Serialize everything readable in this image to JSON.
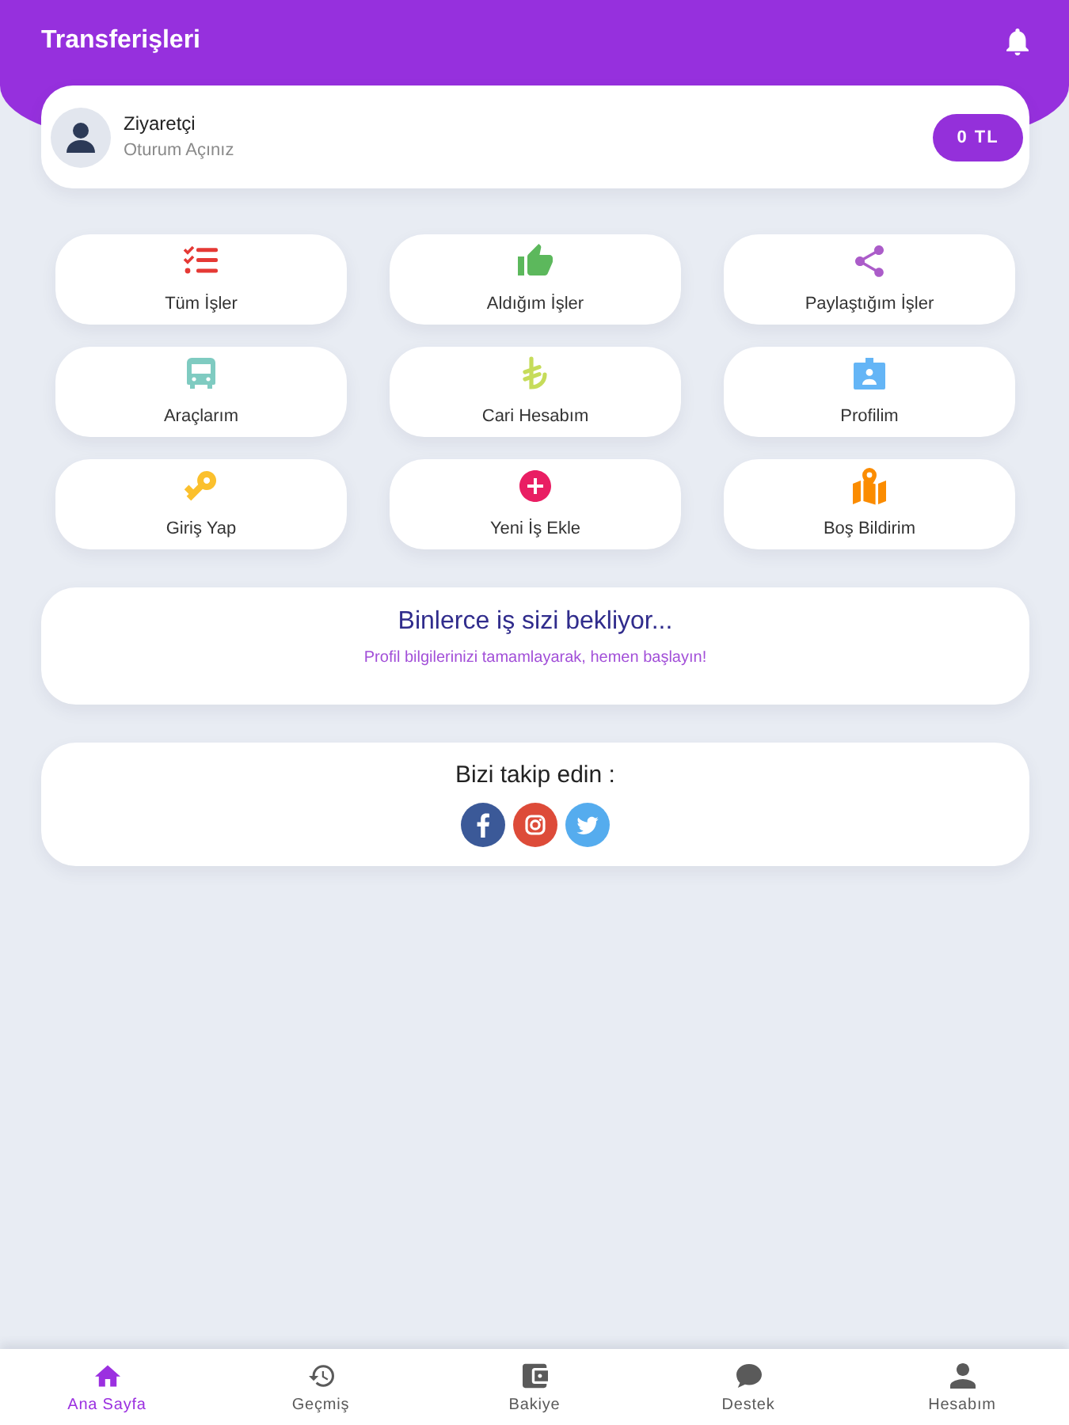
{
  "header": {
    "title": "Transferişleri"
  },
  "user_card": {
    "name": "Ziyaretçi",
    "status": "Oturum Açınız",
    "balance": "0 TL"
  },
  "menu": [
    {
      "label": "Tüm İşler",
      "color": "#e53935"
    },
    {
      "label": "Aldığım İşler",
      "color": "#5cb85c"
    },
    {
      "label": "Paylaştığım İşler",
      "color": "#ab5cc9"
    },
    {
      "label": "Araçlarım",
      "color": "#7fcbc1"
    },
    {
      "label": "Cari Hesabım",
      "color": "#c6dc5a"
    },
    {
      "label": "Profilim",
      "color": "#64b5f6"
    },
    {
      "label": "Giriş Yap",
      "color": "#fbc02d"
    },
    {
      "label": "Yeni İş Ekle",
      "color": "#e91e63"
    },
    {
      "label": "Boş Bildirim",
      "color": "#fb8c00"
    }
  ],
  "banner": {
    "title": "Binlerce iş sizi bekliyor...",
    "subtitle": "Profil bilgilerinizi tamamlayarak, hemen başlayın!"
  },
  "follow": {
    "title": "Bizi takip edin :"
  },
  "bottom_nav": [
    {
      "label": "Ana Sayfa",
      "selected": true
    },
    {
      "label": "Geçmiş",
      "selected": false
    },
    {
      "label": "Bakiye",
      "selected": false
    },
    {
      "label": "Destek",
      "selected": false
    },
    {
      "label": "Hesabım",
      "selected": false
    }
  ]
}
